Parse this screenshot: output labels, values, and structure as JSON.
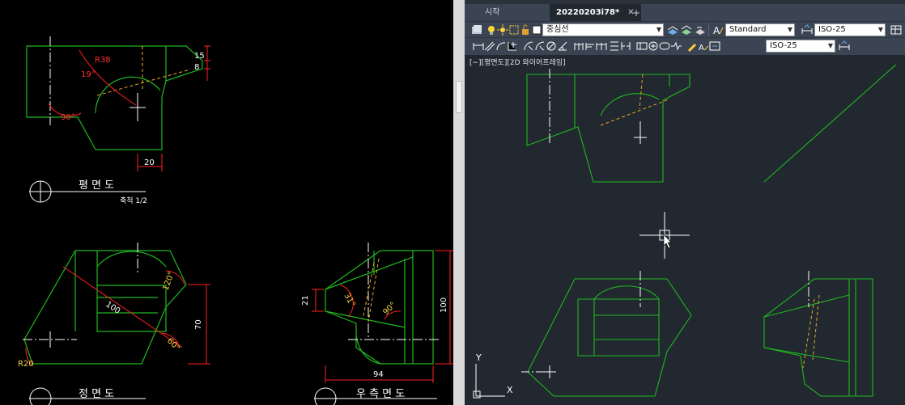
{
  "left_drawing": {
    "top_view": {
      "title": "평 면 도",
      "scale": "축척 1/2",
      "dims": {
        "r38": "R38",
        "ang19": "19°",
        "ang90": "90°",
        "d15": "15",
        "d8": "8",
        "d20": "20"
      }
    },
    "front_view": {
      "title": "정 면 도",
      "dims": {
        "d100": "100",
        "ang120": "120°",
        "ang60": "60°",
        "d70": "70",
        "r20": "R20"
      }
    },
    "side_view": {
      "title": "우 측 면 도",
      "dims": {
        "d21": "21",
        "ang31": "31°",
        "ang90": "90°",
        "d100": "100",
        "d94": "94"
      }
    }
  },
  "autocad": {
    "tabs": {
      "start": "시작",
      "active": "20220203i78*",
      "close": "✕",
      "new": "+"
    },
    "toolbar1": {
      "layer": "중심선",
      "text_style": "Standard",
      "dim_style": "ISO-25"
    },
    "toolbar2": {
      "dim_style": "ISO-25"
    },
    "viewport_label": "[−][평면도][2D 와이어프레임]",
    "ucs": {
      "x": "X",
      "y": "Y"
    }
  },
  "colors": {
    "geometry": "#1fb81f",
    "dimension": "#ff2020",
    "text_yellow": "#ffd24a",
    "hidden_line": "#e8a820",
    "viewport_bg": "#212830",
    "toolbar_bg": "#3b4452"
  }
}
